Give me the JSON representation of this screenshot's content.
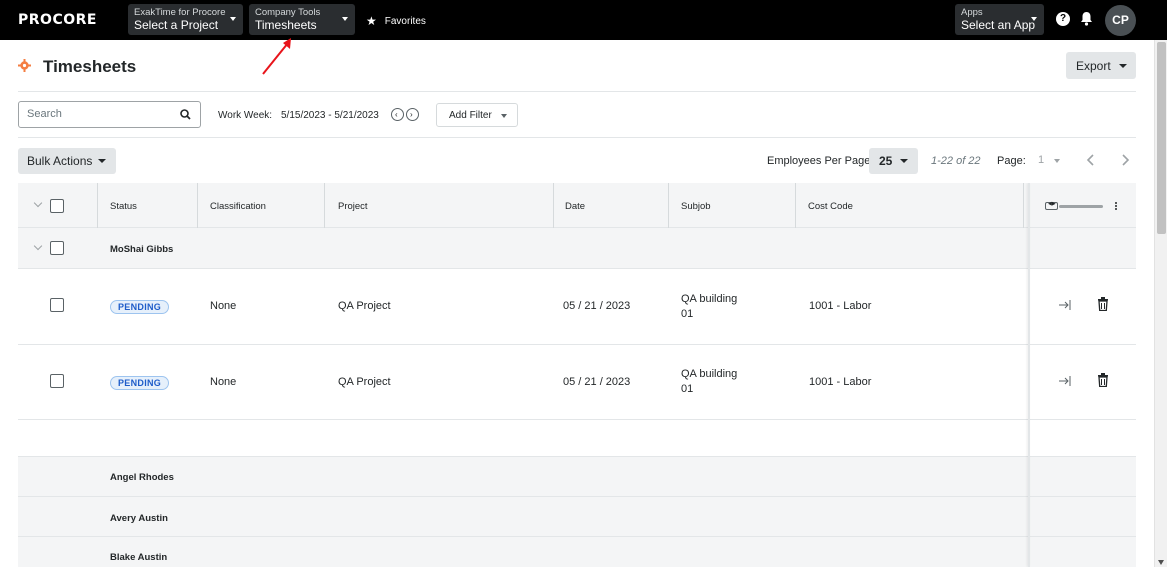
{
  "topnav": {
    "logo": "PROCORE",
    "project_selector": {
      "label": "ExakTime for Procore",
      "value": "Select a Project"
    },
    "tool_selector": {
      "label": "Company Tools",
      "value": "Timesheets"
    },
    "favorites": "Favorites",
    "apps_selector": {
      "label": "Apps",
      "value": "Select an App"
    },
    "help_icon": "?",
    "avatar_initials": "CP"
  },
  "page": {
    "title": "Timesheets",
    "export_label": "Export"
  },
  "filters": {
    "search_placeholder": "Search",
    "work_week_label": "Work Week:",
    "work_week_range": "5/15/2023 - 5/21/2023",
    "prev_week": "‹",
    "next_week": "›",
    "add_filter_label": "Add Filter"
  },
  "toolbar": {
    "bulk_actions_label": "Bulk Actions",
    "employees_per_page_label": "Employees Per Page:",
    "employees_per_page_value": "25",
    "range_text": "1-22 of 22",
    "page_label": "Page:",
    "page_value": "1"
  },
  "table": {
    "columns": [
      "Status",
      "Classification",
      "Project",
      "Date",
      "Subjob",
      "Cost Code"
    ],
    "groups": [
      {
        "name": "MoShai Gibbs",
        "rows": [
          {
            "status": "PENDING",
            "classification": "None",
            "project": "QA Project",
            "date": "05 / 21 / 2023",
            "subjob": "QA building 01",
            "cost_code": "1001 - Labor"
          },
          {
            "status": "PENDING",
            "classification": "None",
            "project": "QA Project",
            "date": "05 / 21 / 2023",
            "subjob": "QA building 01",
            "cost_code": "1001 - Labor"
          }
        ]
      },
      {
        "name": "Angel Rhodes",
        "rows": []
      },
      {
        "name": "Avery Austin",
        "rows": []
      },
      {
        "name": "Blake Austin",
        "rows": []
      }
    ]
  },
  "colors": {
    "nav_bg": "#000000",
    "brand_orange": "#f47e42",
    "badge_blue": "#1d5cc9",
    "annotation_red": "#e8141b"
  }
}
